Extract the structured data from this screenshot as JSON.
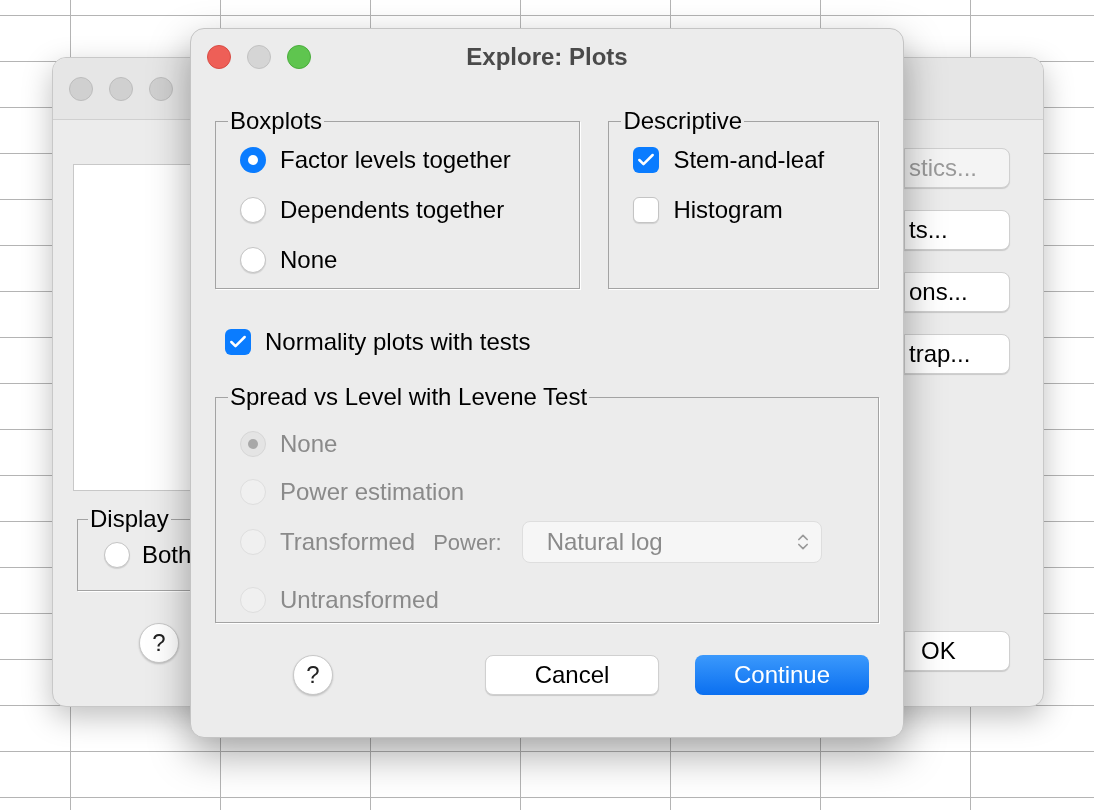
{
  "background_window": {
    "side_buttons": [
      {
        "label": "stics...",
        "disabled": true
      },
      {
        "label": "ts...",
        "disabled": false
      },
      {
        "label": "ons...",
        "disabled": false
      },
      {
        "label": "trap...",
        "disabled": false
      }
    ],
    "display_group": {
      "title": "Display",
      "options": [
        {
          "label": "Both",
          "selected": false
        }
      ]
    },
    "help_button": "?",
    "ok_button": "OK"
  },
  "dialog": {
    "title": "Explore: Plots",
    "boxplots": {
      "title": "Boxplots",
      "options": [
        {
          "label": "Factor levels together",
          "selected": true
        },
        {
          "label": "Dependents together",
          "selected": false
        },
        {
          "label": "None",
          "selected": false
        }
      ]
    },
    "descriptive": {
      "title": "Descriptive",
      "options": [
        {
          "label": "Stem-and-leaf",
          "checked": true
        },
        {
          "label": "Histogram",
          "checked": false
        }
      ]
    },
    "normality": {
      "label": "Normality plots with tests",
      "checked": true
    },
    "spread": {
      "title": "Spread vs Level with Levene Test",
      "disabled": true,
      "options": [
        {
          "label": "None",
          "selected": true
        },
        {
          "label": "Power estimation",
          "selected": false
        },
        {
          "label": "Transformed",
          "selected": false,
          "power": {
            "label": "Power:",
            "value": "Natural log"
          }
        },
        {
          "label": "Untransformed",
          "selected": false
        }
      ]
    },
    "buttons": [
      {
        "kind": "help",
        "label": "?"
      },
      {
        "kind": "normal",
        "label": "Cancel"
      },
      {
        "kind": "default",
        "label": "Continue"
      }
    ]
  }
}
